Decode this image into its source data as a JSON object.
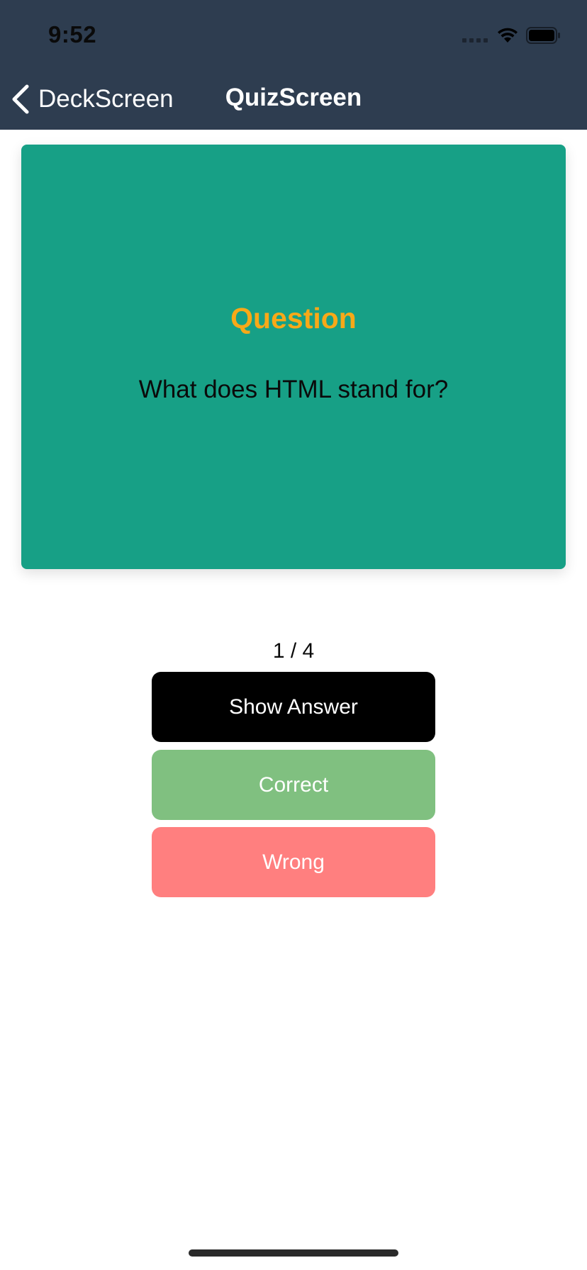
{
  "status_bar": {
    "time": "9:52"
  },
  "nav": {
    "back_label": "DeckScreen",
    "title": "QuizScreen"
  },
  "card": {
    "heading": "Question",
    "text": "What does HTML stand for?"
  },
  "quiz": {
    "progress": "1 / 4",
    "current": 1,
    "total": 4
  },
  "buttons": {
    "show_answer": "Show Answer",
    "correct": "Correct",
    "wrong": "Wrong"
  },
  "colors": {
    "header_bg": "#2e3d50",
    "card_bg": "#17a086",
    "heading": "#f8a918",
    "show_answer_bg": "#000000",
    "correct_bg": "#80c080",
    "wrong_bg": "#ff7f7f"
  },
  "icons": {
    "back": "chevron-left-icon",
    "signal": "cellular-signal-icon",
    "wifi": "wifi-icon",
    "battery": "battery-icon"
  }
}
